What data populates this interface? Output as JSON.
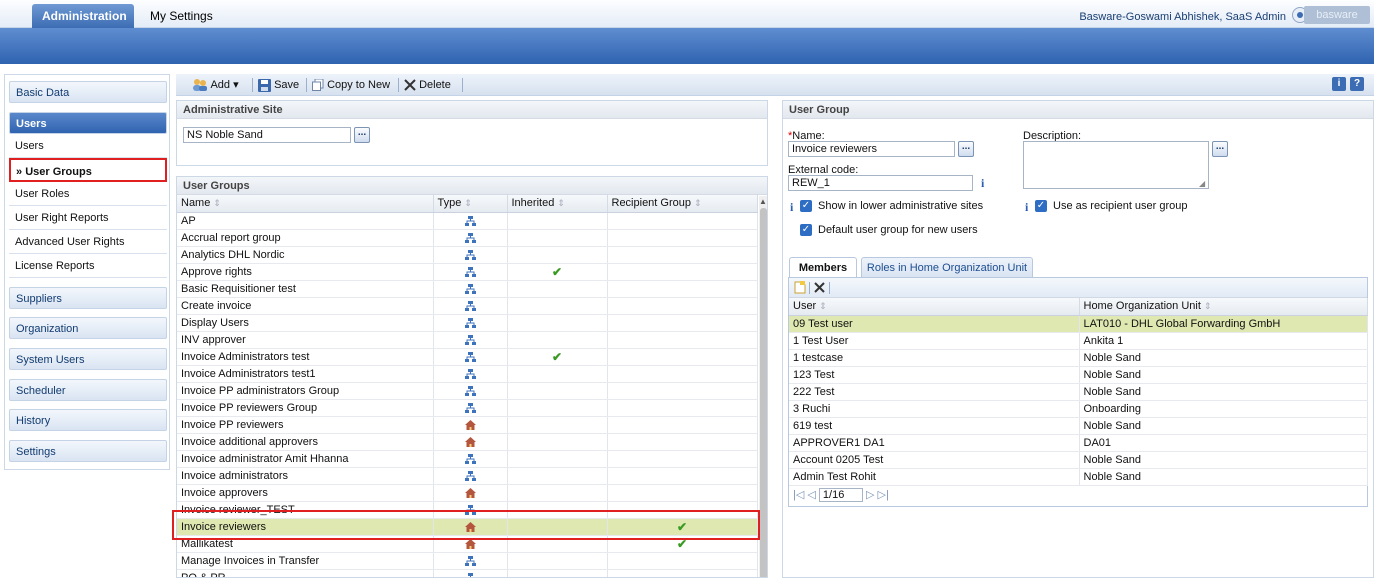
{
  "header": {
    "tabs": [
      "Administration",
      "My Settings"
    ],
    "user": "Basware-Goswami Abhishek, SaaS Admin",
    "logo": "basware"
  },
  "sidebar": {
    "sections_top": [
      "Basic Data",
      "Users"
    ],
    "users_items": [
      "Users",
      "User Groups",
      "User Roles",
      "User Right Reports",
      "Advanced User Rights",
      "License Reports"
    ],
    "selected_prefix": "»",
    "sections_bottom": [
      "Suppliers",
      "Organization",
      "System Users",
      "Scheduler",
      "History",
      "Settings"
    ]
  },
  "toolbar": {
    "add": "Add",
    "save": "Save",
    "copy": "Copy to New",
    "delete": "Delete",
    "info": "i",
    "help": "?"
  },
  "admin_site": {
    "title": "Administrative Site",
    "value": "NS Noble Sand"
  },
  "user_groups": {
    "title": "User Groups",
    "columns": [
      "Name",
      "Type",
      "Inherited",
      "Recipient Group"
    ],
    "rows": [
      {
        "name": "AP",
        "type": "network-icon",
        "inherited": "",
        "recipient": ""
      },
      {
        "name": "Accrual report group",
        "type": "network-icon",
        "inherited": "",
        "recipient": ""
      },
      {
        "name": "Analytics DHL Nordic",
        "type": "network-icon",
        "inherited": "",
        "recipient": ""
      },
      {
        "name": "Approve rights",
        "type": "network-icon",
        "inherited": "✔",
        "recipient": ""
      },
      {
        "name": "Basic Requisitioner test",
        "type": "network-icon",
        "inherited": "",
        "recipient": ""
      },
      {
        "name": "Create invoice",
        "type": "network-icon",
        "inherited": "",
        "recipient": ""
      },
      {
        "name": "Display Users",
        "type": "network-icon",
        "inherited": "",
        "recipient": ""
      },
      {
        "name": "INV approver",
        "type": "network-icon",
        "inherited": "",
        "recipient": ""
      },
      {
        "name": "Invoice Administrators test",
        "type": "network-icon",
        "inherited": "✔",
        "recipient": ""
      },
      {
        "name": "Invoice Administrators test1",
        "type": "network-icon",
        "inherited": "",
        "recipient": ""
      },
      {
        "name": "Invoice PP administrators Group",
        "type": "network-icon",
        "inherited": "",
        "recipient": ""
      },
      {
        "name": "Invoice PP reviewers Group",
        "type": "network-icon",
        "inherited": "",
        "recipient": ""
      },
      {
        "name": "Invoice PP reviewers",
        "type": "home-icon",
        "inherited": "",
        "recipient": ""
      },
      {
        "name": "Invoice additional approvers",
        "type": "home-icon",
        "inherited": "",
        "recipient": ""
      },
      {
        "name": "Invoice administrator Amit Hhanna",
        "type": "network-icon",
        "inherited": "",
        "recipient": ""
      },
      {
        "name": "Invoice administrators",
        "type": "network-icon",
        "inherited": "",
        "recipient": ""
      },
      {
        "name": "Invoice approvers",
        "type": "home-icon",
        "inherited": "",
        "recipient": ""
      },
      {
        "name": "Invoice reviewer_TEST",
        "type": "network-icon",
        "inherited": "",
        "recipient": ""
      },
      {
        "name": "Invoice reviewers",
        "type": "home-icon",
        "inherited": "",
        "recipient": "✔",
        "selected": true
      },
      {
        "name": "Mallikatest",
        "type": "home-icon",
        "inherited": "",
        "recipient": "✔"
      },
      {
        "name": "Manage Invoices in Transfer",
        "type": "network-icon",
        "inherited": "",
        "recipient": ""
      },
      {
        "name": "PO & PR",
        "type": "network-icon",
        "inherited": "",
        "recipient": ""
      }
    ]
  },
  "user_group_form": {
    "title": "User Group",
    "name_label": "Name:",
    "required_mark": "*",
    "name_value": "Invoice reviewers",
    "description_label": "Description:",
    "description_value": "",
    "external_code_label": "External code:",
    "external_code_value": "REW_1",
    "show_lower_label": "Show in lower administrative sites",
    "use_recipient_label": "Use as recipient user group",
    "default_group_label": "Default user group for new users",
    "btn_dots": "..."
  },
  "members": {
    "tabs": [
      "Members",
      "Roles in Home Organization Unit"
    ],
    "columns": [
      "User",
      "Home Organization Unit"
    ],
    "rows": [
      {
        "user": "09 Test user",
        "unit": "LAT010 - DHL Global Forwarding GmbH",
        "selected": true
      },
      {
        "user": "1 Test User",
        "unit": "Ankita 1"
      },
      {
        "user": "1 testcase",
        "unit": "Noble Sand"
      },
      {
        "user": "123 Test",
        "unit": "Noble Sand"
      },
      {
        "user": "222 Test",
        "unit": "Noble Sand"
      },
      {
        "user": "3 Ruchi",
        "unit": "Onboarding"
      },
      {
        "user": "619 test",
        "unit": "Noble Sand"
      },
      {
        "user": "APPROVER1 DA1",
        "unit": "DA01"
      },
      {
        "user": "Account 0205 Test",
        "unit": "Noble Sand"
      },
      {
        "user": "Admin Test Rohit",
        "unit": "Noble Sand"
      }
    ],
    "page": "1/16"
  }
}
